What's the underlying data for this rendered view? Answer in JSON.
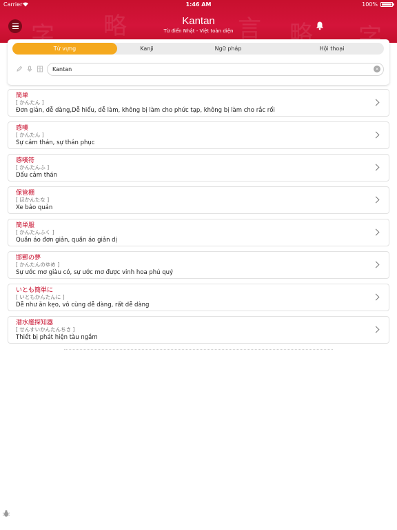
{
  "status_bar": {
    "carrier": "Carrier",
    "time": "1:46 AM",
    "battery": "100%"
  },
  "header": {
    "title": "Kantan",
    "subtitle": "Từ điển Nhật - Việt toàn diện",
    "color": "#c8102e"
  },
  "tabs": [
    {
      "label": "Từ vựng",
      "active": true
    },
    {
      "label": "Kanji",
      "active": false
    },
    {
      "label": "Ngữ pháp",
      "active": false
    },
    {
      "label": "Hội thoại",
      "active": false
    }
  ],
  "tools": [
    "pencil-icon",
    "microphone-icon",
    "kanji-icon"
  ],
  "search": {
    "value": "Kantan",
    "placeholder": ""
  },
  "results": [
    {
      "kanji": "簡単",
      "reading": "[ かんたん ]",
      "meaning": "Đơn giản, dễ dàng,Dễ hiểu, dễ làm, không bị làm cho phức tạp, không bị làm cho rắc rối"
    },
    {
      "kanji": "感嘆",
      "reading": "[ かんたん ]",
      "meaning": "Sự cảm thán, sự thán phục"
    },
    {
      "kanji": "感嘆符",
      "reading": "[ かんたんふ ]",
      "meaning": "Dấu cảm thán"
    },
    {
      "kanji": "保管棚",
      "reading": "[ ほかんたな ]",
      "meaning": "Xe bảo quản"
    },
    {
      "kanji": "簡単服",
      "reading": "[ かんたんふく ]",
      "meaning": "Quần áo đơn giản, quần áo giản dị"
    },
    {
      "kanji": "邯鄲の夢",
      "reading": "[ かんたんのゆめ ]",
      "meaning": "Sự ước mơ giàu có, sự ước mơ được vinh hoa phú quý"
    },
    {
      "kanji": "いとも簡単に",
      "reading": "[ いともかんたんに ]",
      "meaning": "Dễ như ăn kẹo, vô cùng dễ dàng, rất dễ dàng"
    },
    {
      "kanji": "潜水艦探知器",
      "reading": "[ せんすいかんたんちき ]",
      "meaning": "Thiết bị phát hiện tàu ngầm"
    }
  ]
}
